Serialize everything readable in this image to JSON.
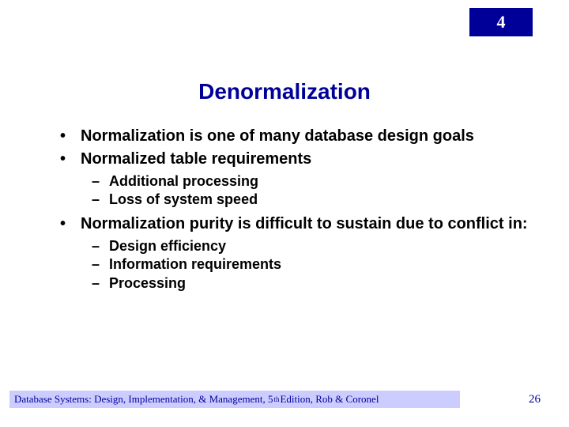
{
  "chapter": "4",
  "title": "Denormalization",
  "bullets": [
    {
      "text": "Normalization is one of many database design goals",
      "sub": []
    },
    {
      "text": "Normalized table requirements",
      "sub": [
        "Additional processing",
        "Loss of system speed"
      ]
    },
    {
      "text": "Normalization purity is difficult to sustain due to conflict in:",
      "sub": [
        "Design efficiency",
        "Information requirements",
        "Processing"
      ]
    }
  ],
  "footer": {
    "prefix": "Database Systems: Design, Implementation, & Management, 5",
    "ord": "th",
    "suffix": " Edition, Rob & Coronel"
  },
  "page_number": "26"
}
